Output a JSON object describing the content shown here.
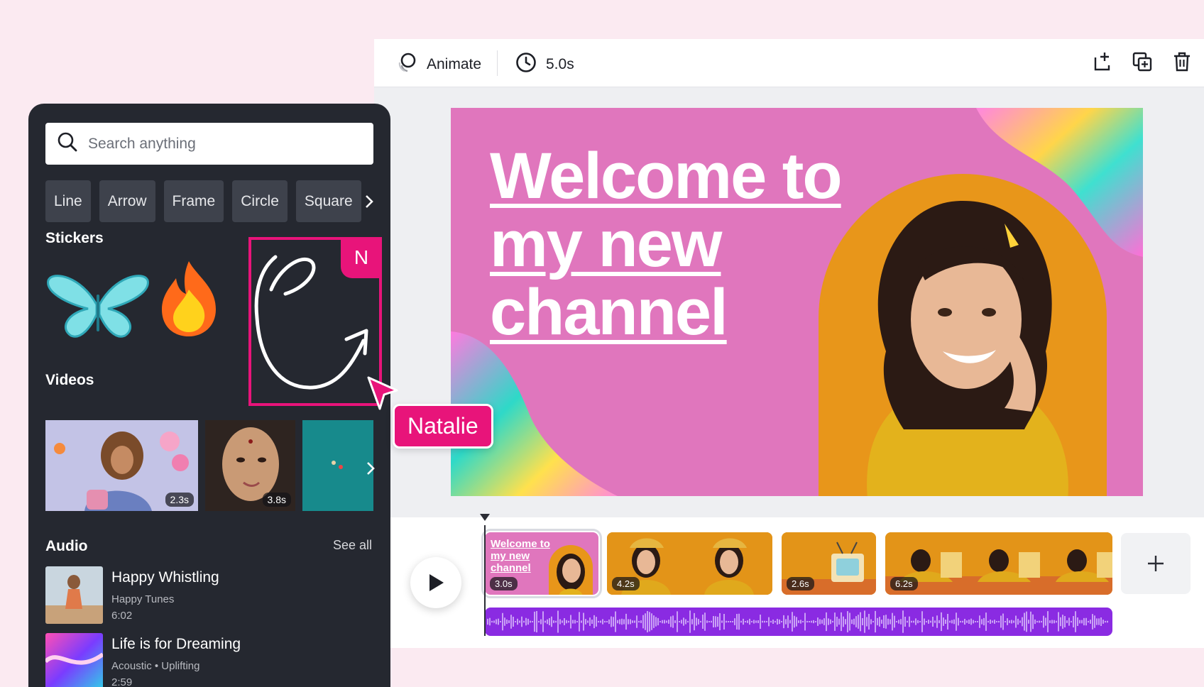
{
  "toolbar": {
    "animate_label": "Animate",
    "duration_label": "5.0s",
    "icons": [
      "add-page-icon",
      "duplicate-icon",
      "trash-icon"
    ]
  },
  "slide": {
    "title": "Welcome to my new channel",
    "colors": {
      "background": "#e076bd",
      "arch": "#e8961a"
    }
  },
  "timeline": {
    "clips": [
      {
        "duration": "3.0s",
        "thumb_title": "Welcome to my new channel",
        "selected": true
      },
      {
        "duration": "4.2s"
      },
      {
        "duration": "2.6s"
      },
      {
        "duration": "6.2s"
      }
    ],
    "audio_color": "#8a2be2"
  },
  "panel": {
    "search_placeholder": "Search anything",
    "chips": [
      "Line",
      "Arrow",
      "Frame",
      "Circle",
      "Square"
    ],
    "stickers_title": "Stickers",
    "selected_badge": "N",
    "videos_title": "Videos",
    "videos": [
      {
        "duration": "2.3s"
      },
      {
        "duration": "3.8s"
      },
      {
        "duration": ""
      }
    ],
    "audio_title": "Audio",
    "see_all": "See all",
    "audio": [
      {
        "name": "Happy Whistling",
        "artist": "Happy Tunes",
        "duration": "6:02"
      },
      {
        "name": "Life is for Dreaming",
        "artist": "Acoustic • Uplifting",
        "duration": "2:59"
      }
    ]
  },
  "collaborator": {
    "name": "Natalie",
    "color": "#e8147a"
  }
}
